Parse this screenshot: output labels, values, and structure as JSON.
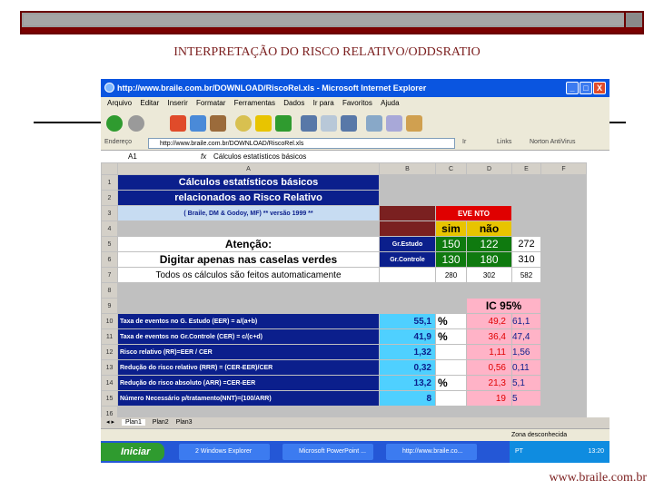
{
  "slide": {
    "title": "INTERPRETAÇÃO DO RISCO RELATIVO/ODDSRATIO",
    "footer": "www.braile.com.br"
  },
  "window": {
    "title": "http://www.braile.com.br/DOWNLOAD/RiscoRel.xls - Microsoft Internet Explorer",
    "min": "_",
    "max": "□",
    "close": "X"
  },
  "menu": [
    "Arquivo",
    "Editar",
    "Inserir",
    "Formatar",
    "Ferramentas",
    "Dados",
    "Ir para",
    "Favoritos",
    "Ajuda"
  ],
  "address": {
    "label": "Endereço",
    "url": "http://www.braile.com.br/DOWNLOAD/RiscoRel.xls",
    "go": "Ir",
    "links": "Links",
    "norton": "Norton AntiVirus"
  },
  "formula": {
    "cell": "A1",
    "fx": "fx",
    "content": "Cálculos estatísticos básicos"
  },
  "columns": [
    "A",
    "B",
    "C",
    "D",
    "E",
    "F"
  ],
  "rows": [
    "1",
    "2",
    "3",
    "4",
    "5",
    "6",
    "7",
    "8",
    "9",
    "10",
    "11",
    "12",
    "13",
    "14",
    "15",
    "16"
  ],
  "sheet": {
    "title1": "Cálculos estatísticos básicos",
    "title2": "relacionados ao Risco Relativo",
    "credit": "( Braile, DM & Godoy, MF)  **  versão 1999 **",
    "evento": "EVE NTO",
    "sim": "sim",
    "nao": "não",
    "atencao": "Atenção:",
    "digitar": "Digitar apenas nas caselas verdes",
    "todos": "Todos os cálculos são feitos automaticamente",
    "gr_estudo": "Gr.Estudo",
    "gr_controle": "Gr.Controle",
    "estudo_sim": "150",
    "estudo_nao": "122",
    "estudo_total": "272",
    "controle_sim": "130",
    "controle_nao": "180",
    "controle_total": "310",
    "total_sim": "280",
    "total_nao": "302",
    "total": "582",
    "ic": "IC  95%",
    "calcs": [
      {
        "label": "Taxa de eventos no G. Estudo (EER) = a/(a+b)",
        "value": "55,1",
        "pct": "%",
        "lo": "49,2",
        "hi": "61,1"
      },
      {
        "label": "Taxa de eventos no Gr.Controle (CER) = c/(c+d)",
        "value": "41,9",
        "pct": "%",
        "lo": "36,4",
        "hi": "47,4"
      },
      {
        "label": "Risco relativo (RR)=EER / CER",
        "value": "1,32",
        "pct": "",
        "lo": "1,11",
        "hi": "1,56"
      },
      {
        "label": "Redução do risco relativo (RRR) = (CER-EER)/CER",
        "value": "0,32",
        "pct": "",
        "lo": "0,56",
        "hi": "0,11"
      },
      {
        "label": "Redução do risco absoluto (ARR) =CER-EER",
        "value": "13,2",
        "pct": "%",
        "lo": "21,3",
        "hi": "5,1"
      },
      {
        "label": "Número Necessário p/tratamento(NNT)=(100/ARR)",
        "value": "8",
        "pct": "",
        "lo": "19",
        "hi": "5"
      }
    ]
  },
  "tabs": [
    "Plan1",
    "Plan2",
    "Plan3"
  ],
  "status": "Zona desconhecida",
  "taskbar": {
    "start": "Iniciar",
    "tasks": [
      "2 Windows Explorer",
      "Microsoft PowerPoint ...",
      "http://www.braile.co..."
    ],
    "tray": "PT",
    "clock": "13:20"
  },
  "colors": {
    "navy": "#0b1f8c",
    "green": "#0f7a0f",
    "gold": "#e8c400",
    "maroon": "#7a2020",
    "cyan": "#4fd0ff",
    "pink": "#ffb3c7"
  }
}
